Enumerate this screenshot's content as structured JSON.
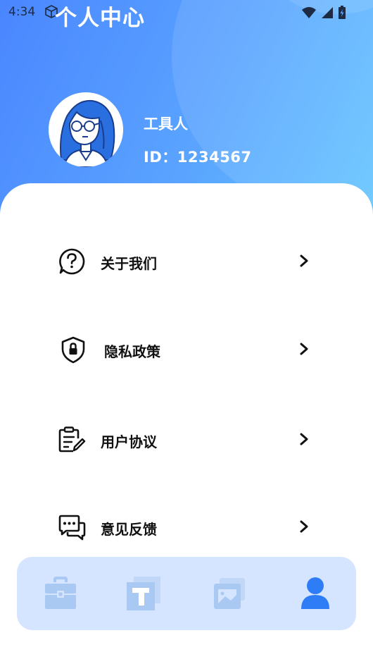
{
  "status_bar": {
    "time": "4:34",
    "icons": [
      "cube-icon",
      "wifi-icon",
      "signal-icon",
      "battery-icon"
    ]
  },
  "header": {
    "title": "个人中心"
  },
  "profile": {
    "name": "工具人",
    "id_text": "ID：1234567",
    "avatar": "avatar-girl-with-glasses"
  },
  "menu": {
    "items": [
      {
        "label": "关于我们",
        "icon": "question-bubble-icon"
      },
      {
        "label": "隐私政策",
        "icon": "shield-lock-icon"
      },
      {
        "label": "用户协议",
        "icon": "clipboard-pen-icon"
      },
      {
        "label": "意见反馈",
        "icon": "chat-bubbles-icon"
      }
    ]
  },
  "tabbar": {
    "tabs": [
      {
        "icon": "toolbox-icon",
        "active": false
      },
      {
        "icon": "text-tool-icon",
        "active": false
      },
      {
        "icon": "image-cards-icon",
        "active": false
      },
      {
        "icon": "user-icon",
        "active": true
      }
    ]
  },
  "colors": {
    "gradient_start": "#4a86ff",
    "gradient_end": "#62c6ff",
    "tab_inactive": "#a9c8f2",
    "tab_active": "#2f7df6",
    "tabbar_bg": "#d6e5ff"
  }
}
